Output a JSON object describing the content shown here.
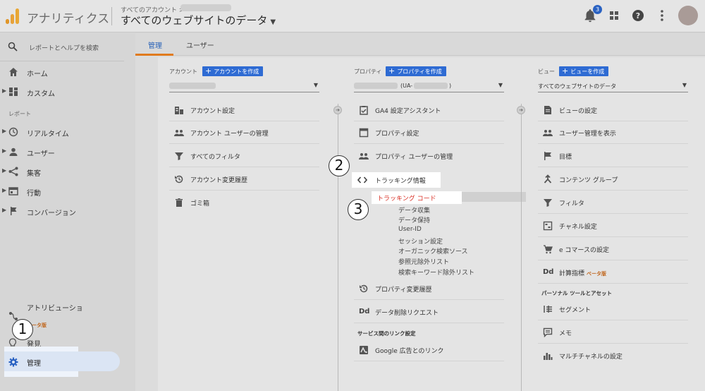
{
  "header": {
    "app_title": "アナリティクス",
    "breadcrumb": "すべてのアカウント >",
    "view_selector": "すべてのウェブサイトのデータ",
    "notification_count": "3"
  },
  "sidebar": {
    "search_placeholder": "レポートとヘルプを検索",
    "home": "ホーム",
    "custom": "カスタム",
    "reports_section": "レポート",
    "reports": [
      {
        "label": "リアルタイム",
        "icon": "clock-icon"
      },
      {
        "label": "ユーザー",
        "icon": "person-icon"
      },
      {
        "label": "集客",
        "icon": "acquisition-icon"
      },
      {
        "label": "行動",
        "icon": "behavior-icon"
      },
      {
        "label": "コンバージョン",
        "icon": "flag-icon"
      }
    ],
    "attribution": "アトリビューショ",
    "attribution_beta": "ベータ版",
    "discover": "発見",
    "admin": "管理"
  },
  "tabs": {
    "admin": "管理",
    "user": "ユーザー"
  },
  "account_col": {
    "heading": "アカウント",
    "create": "アカウントを作成",
    "items": [
      {
        "label": "アカウント設定",
        "icon": "building-icon"
      },
      {
        "label": "アカウント ユーザーの管理",
        "icon": "people-icon"
      },
      {
        "label": "すべてのフィルタ",
        "icon": "filter-icon"
      },
      {
        "label": "アカウント変更履歴",
        "icon": "history-icon"
      },
      {
        "label": "ゴミ箱",
        "icon": "trash-icon"
      }
    ]
  },
  "property_col": {
    "heading": "プロパティ",
    "create": "プロパティを作成",
    "selector_suffix": "(UA-",
    "selector_close": ")",
    "items": [
      {
        "label": "GA4 設定アシスタント",
        "icon": "checklist-icon"
      },
      {
        "label": "プロパティ設定",
        "icon": "property-icon"
      },
      {
        "label": "プロパティ ユーザーの管理",
        "icon": "people-icon"
      }
    ],
    "tracking_info": "トラッキング情報",
    "tracking_code": "トラッキング コード",
    "tracking_sub": [
      "データ収集",
      "データ保持",
      "User-ID",
      "セッション設定",
      "オーガニック検索ソース",
      "参照元除外リスト",
      "検索キーワード除外リスト"
    ],
    "change_history": "プロパティ変更履歴",
    "data_deletion": "データ削除リクエスト",
    "link_section": "サービス間のリンク設定",
    "google_ads": "Google 広告とのリンク"
  },
  "view_col": {
    "heading": "ビュー",
    "create": "ビューを作成",
    "selector_value": "すべてのウェブサイトのデータ",
    "items": [
      {
        "label": "ビューの設定",
        "icon": "document-icon"
      },
      {
        "label": "ユーザー管理を表示",
        "icon": "people-icon"
      },
      {
        "label": "目標",
        "icon": "flag-icon"
      },
      {
        "label": "コンテンツ グループ",
        "icon": "content-group-icon"
      },
      {
        "label": "フィルタ",
        "icon": "filter-icon"
      },
      {
        "label": "チャネル設定",
        "icon": "channel-icon"
      },
      {
        "label": "e コマースの設定",
        "icon": "cart-icon"
      },
      {
        "label": "計算指標",
        "icon": "dd-icon",
        "beta": "ベータ版"
      }
    ],
    "personal_section": "パーソナル ツールとアセット",
    "personal_items": [
      {
        "label": "セグメント",
        "icon": "segment-icon"
      },
      {
        "label": "メモ",
        "icon": "memo-icon"
      },
      {
        "label": "マルチチャネルの設定",
        "icon": "bar-chart-icon"
      }
    ]
  },
  "callouts": [
    "1",
    "2",
    "3"
  ],
  "colors": {
    "accent_blue": "#2e6bd3",
    "tab_underline": "#e07b1e",
    "highlight_red": "#d93025",
    "beta_orange": "#c0651b"
  }
}
